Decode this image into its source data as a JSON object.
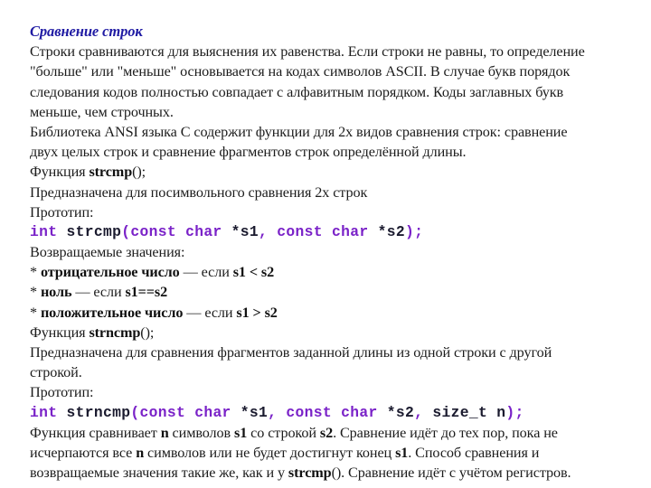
{
  "colors": {
    "title": "#1f1aa3",
    "keyword": "#7a22c8",
    "identifier": "#1a1a2e",
    "text": "#1c1c1c"
  },
  "title": "Сравнение строк",
  "intro": {
    "line1": "Строки сравниваются для выяснения их равенства. Если строки не равны, то определение",
    "line2": "\"больше\" или \"меньше\" основывается на кодах символов ASCII. В случае букв порядок",
    "line3": "следования кодов полностью совпадает с алфавитным порядком. Коды заглавных букв",
    "line4": "меньше, чем строчных.",
    "line5": "Библиотека ANSI языка С содержит функции для 2х видов сравнения строк: сравнение",
    "line6": "двух целых строк и сравнение фрагментов строк определённой длины."
  },
  "strcmp": {
    "func_prefix": "Функция ",
    "func_name": "strcmp",
    "func_suffix": "();",
    "description": "Предназначена для посимвольного сравнения 2х строк",
    "prototype_label": "Прототип:",
    "prototype": {
      "kw_int": "int",
      "name": " strcmp",
      "open": "(",
      "kw_const1": "const",
      "kw_char1": " char",
      "arg1": " *s1",
      "comma": ",",
      "kw_const2": " const",
      "kw_char2": " char",
      "arg2": " *s2",
      "close": ");"
    },
    "returns_label": "Возвращаемые значения:",
    "returns": [
      {
        "bullet": "* ",
        "term": "отрицательное число",
        "dash": " — если ",
        "cond": "s1 < s2"
      },
      {
        "bullet": "* ",
        "term": "ноль",
        "dash": " — если ",
        "cond": "s1==s2"
      },
      {
        "bullet": "* ",
        "term": "положительное число",
        "dash": " — если ",
        "cond": "s1 > s2"
      }
    ]
  },
  "strncmp": {
    "func_prefix": "Функция ",
    "func_name": "strncmp",
    "func_suffix": "();",
    "description_line1": "Предназначена для сравнения фрагментов заданной длины из одной строки с другой",
    "description_line2": "строкой.",
    "prototype_label": "Прототип:",
    "prototype": {
      "kw_int": "int",
      "name": " strncmp",
      "open": "(",
      "kw_const1": "const",
      "kw_char1": " char",
      "arg1": " *s1",
      "comma1": ",",
      "kw_const2": " const",
      "kw_char2": " char",
      "arg2": " *s2",
      "comma2": ",",
      "arg3": " size_t n",
      "close": ");"
    },
    "explanation": {
      "l1_a": "Функция сравнивает ",
      "l1_n": "n",
      "l1_b": " символов ",
      "l1_s1": "s1",
      "l1_c": " со строкой ",
      "l1_s2": "s2",
      "l1_d": ". Сравнение идёт до тех пор, пока не",
      "l2_a": "исчерпаются все ",
      "l2_n": "n",
      "l2_b": " символов или не будет достигнут конец ",
      "l2_s1": "s1",
      "l2_c": ". Способ сравнения и",
      "l3_a": "возвращаемые значения такие же, как и у ",
      "l3_fn": "strcmp",
      "l3_b": "(). Сравнение идёт с учётом регистров."
    }
  }
}
